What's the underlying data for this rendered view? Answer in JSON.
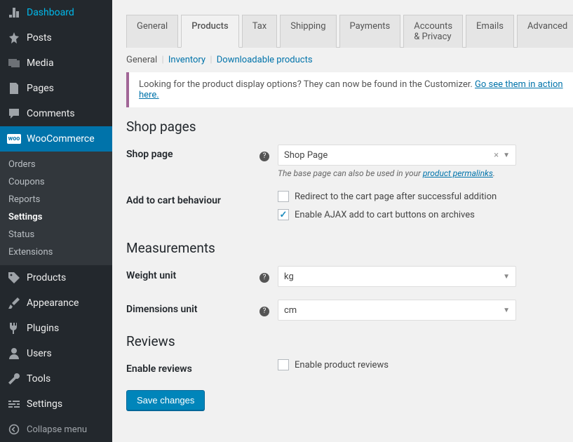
{
  "sidebar": {
    "items": [
      {
        "label": "Dashboard",
        "icon": "dashboard"
      },
      {
        "label": "Posts",
        "icon": "pin"
      },
      {
        "label": "Media",
        "icon": "media"
      },
      {
        "label": "Pages",
        "icon": "page"
      },
      {
        "label": "Comments",
        "icon": "comment"
      },
      {
        "label": "WooCommerce",
        "icon": "woo",
        "active": true
      },
      {
        "label": "Products",
        "icon": "tag"
      },
      {
        "label": "Appearance",
        "icon": "brush"
      },
      {
        "label": "Plugins",
        "icon": "plug"
      },
      {
        "label": "Users",
        "icon": "user"
      },
      {
        "label": "Tools",
        "icon": "wrench"
      },
      {
        "label": "Settings",
        "icon": "sliders"
      }
    ],
    "submenu": [
      "Orders",
      "Coupons",
      "Reports",
      "Settings",
      "Status",
      "Extensions"
    ],
    "submenu_active": "Settings",
    "collapse": "Collapse menu"
  },
  "tabs": [
    "General",
    "Products",
    "Tax",
    "Shipping",
    "Payments",
    "Accounts & Privacy",
    "Emails",
    "Advanced"
  ],
  "active_tab": "Products",
  "subtabs": [
    "General",
    "Inventory",
    "Downloadable products"
  ],
  "active_subtab": "General",
  "notice": {
    "text": "Looking for the product display options? They can now be found in the Customizer. ",
    "link": "Go see them in action here."
  },
  "sections": {
    "shop_pages": {
      "heading": "Shop pages",
      "shop_page": {
        "label": "Shop page",
        "value": "Shop Page",
        "hint_pre": "The base page can also be used in your ",
        "hint_link": "product permalinks",
        "hint_post": "."
      },
      "add_to_cart": {
        "label": "Add to cart behaviour",
        "opt1": "Redirect to the cart page after successful addition",
        "opt1_checked": false,
        "opt2": "Enable AJAX add to cart buttons on archives",
        "opt2_checked": true
      }
    },
    "measurements": {
      "heading": "Measurements",
      "weight": {
        "label": "Weight unit",
        "value": "kg"
      },
      "dimensions": {
        "label": "Dimensions unit",
        "value": "cm"
      }
    },
    "reviews": {
      "heading": "Reviews",
      "enable": {
        "label": "Enable reviews",
        "opt": "Enable product reviews",
        "checked": false
      }
    }
  },
  "save_button": "Save changes"
}
